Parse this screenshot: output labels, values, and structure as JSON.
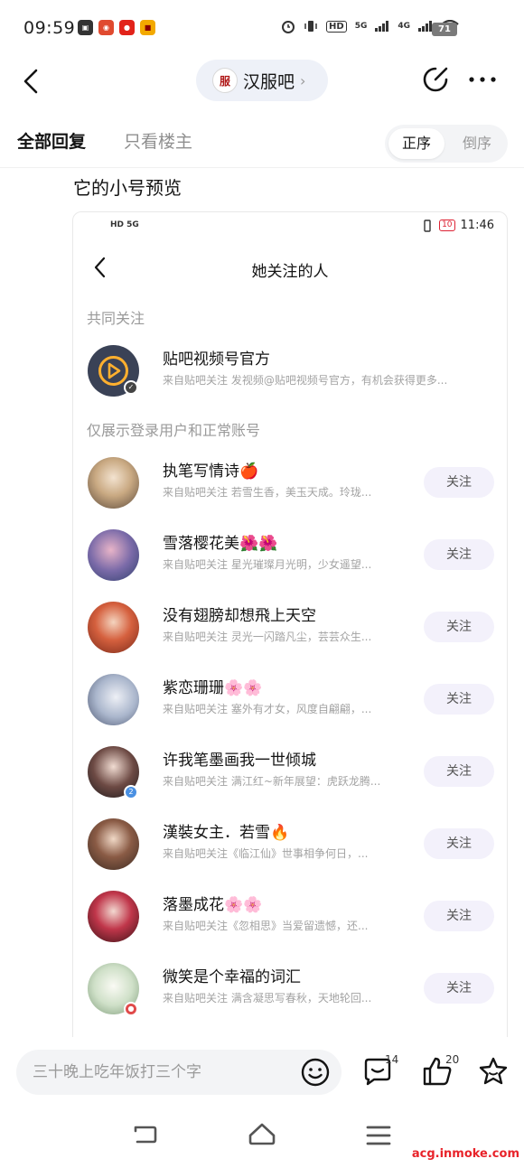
{
  "status_bar": {
    "time": "09:59",
    "network_1": "5G",
    "network_2": "4G",
    "hd_label": "HD",
    "battery": "71"
  },
  "header": {
    "forum_logo_text": "服",
    "forum_name": "汉服吧"
  },
  "tabs": {
    "all_replies": "全部回复",
    "op_only": "只看楼主",
    "sort_asc": "正序",
    "sort_desc": "倒序"
  },
  "post": {
    "text": "它的小号预览"
  },
  "screenshot": {
    "status_left": "HD 5G",
    "status_battery": "10",
    "status_time": "11:46",
    "title": "她关注的人",
    "section_common": "共同关注",
    "section_visible": "仅展示登录用户和正常账号",
    "common_item": {
      "name": "贴吧视频号官方",
      "desc": "来自贴吧关注 发视频@贴吧视频号官方，有机会获得更多..."
    },
    "follow_label": "关注",
    "rows": [
      {
        "name": "执笔写情诗🍎",
        "desc": "来自贴吧关注 若雪生香，美玉天成。玲珑..."
      },
      {
        "name": "雪落樱花美🌺🌺",
        "desc": "来自贴吧关注 星光璀璨月光明，少女遥望..."
      },
      {
        "name": "没有翅膀却想飛上天空",
        "desc": "来自贴吧关注 灵光一闪踏凡尘，芸芸众生..."
      },
      {
        "name": "紫恋珊珊🌸🌸",
        "desc": "来自贴吧关注 塞外有才女，风度自翩翩，..."
      },
      {
        "name": "许我笔墨画我一世倾城",
        "desc": "来自贴吧关注 满江红~新年展望：虎跃龙腾..."
      },
      {
        "name": "漢裝女主．若雪🔥",
        "desc": "来自贴吧关注《临江仙》世事相争何日，..."
      },
      {
        "name": "落墨成花🌸🌸",
        "desc": "来自贴吧关注《忽相思》当爱留遗憾，还..."
      },
      {
        "name": "微笑是个幸福的词汇",
        "desc": "来自贴吧关注 满含凝思写春秋，天地轮回..."
      }
    ]
  },
  "bottom_bar": {
    "input_placeholder": "三十晚上吃年饭打三个字",
    "comment_count": "14",
    "like_count": "20"
  },
  "watermark": "acg.inmoke.com",
  "colors": {
    "accent_pill": "#eef1f8",
    "follow_bg": "#f3f1fb",
    "watermark": "#e8232a"
  }
}
